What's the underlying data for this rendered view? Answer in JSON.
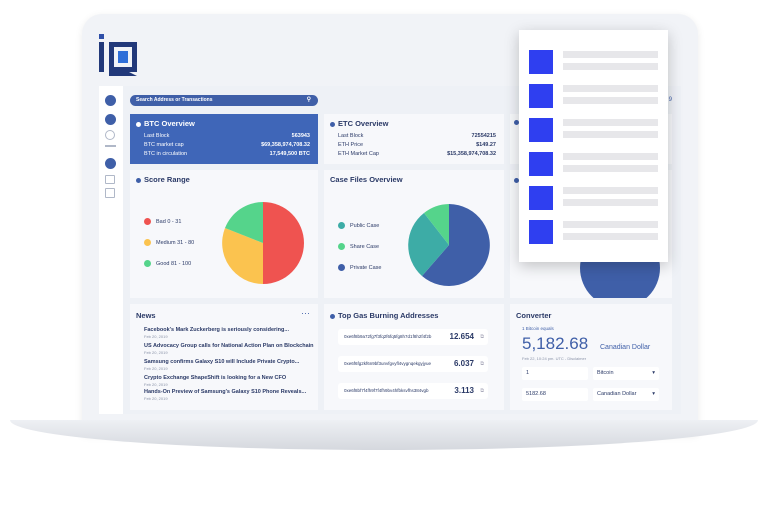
{
  "search": {
    "placeholder": "Search Address or Transactions",
    "icon": "search-icon"
  },
  "btc": {
    "title": "BTC Overview",
    "rows": [
      {
        "label": "Last Block",
        "value": "563943"
      },
      {
        "label": "BTC market cap",
        "value": "$69,358,974,708.32"
      },
      {
        "label": "BTC in circulation",
        "value": "17,549,500 BTC"
      }
    ]
  },
  "etc": {
    "title": "ETC Overview",
    "rows": [
      {
        "label": "Last Block",
        "value": "72554215"
      },
      {
        "label": "ETH Price",
        "value": "$149.27"
      },
      {
        "label": "ETH Market Cap",
        "value": "$15,358,974,708.32"
      }
    ]
  },
  "partial_value": "9",
  "score": {
    "title": "Score Range",
    "legend": [
      "Bad 0 - 31",
      "Medium 31 - 80",
      "Good 81 - 100"
    ],
    "colors": [
      "#ef5350",
      "#fbc34f",
      "#55d48b"
    ]
  },
  "casefiles": {
    "title": "Case Files Overview",
    "legend": [
      "Public Case",
      "Share Case",
      "Private Case"
    ],
    "colors": [
      "#3daca6",
      "#55d48b",
      "#3f5fa8"
    ]
  },
  "news": {
    "title": "News",
    "items": [
      {
        "title": "Facebook's Mark Zuckerberg is seriously considering...",
        "date": "Feb 20, 2019"
      },
      {
        "title": "US Advocacy Group calls for National Action Plan on Blockchain",
        "date": "Feb 20, 2019"
      },
      {
        "title": "Samsung confirms Galaxy S10 will Include Private Crypto...",
        "date": "Feb 20, 2019"
      },
      {
        "title": "Crypto Exchange ShapeShift is looking for a New CFO",
        "date": "Feb 20, 2019"
      },
      {
        "title": "Hands-On Preview of Samsung's Galaxy S10 Phone Reveals...",
        "date": "Feb 20, 2019"
      }
    ]
  },
  "gas": {
    "title": "Top Gas Burning Addresses",
    "rows": [
      {
        "address": "0xe6f8b9a72fg7f3fq2f6fq5fg8h7d1f8h2f4f2b",
        "value": "12.654"
      },
      {
        "address": "0xe6f6fg2kf6n9bf3unvfgvyfl4vygnqekgyjyue",
        "value": "6.037"
      },
      {
        "address": "0xe6f8bf7f4fh9f7f4fh9bv4hfbksvfhs384vgb",
        "value": "3.113"
      }
    ]
  },
  "converter": {
    "title": "Converter",
    "equals": "1 Bitcoin equals",
    "amount": "5,182.68",
    "currency": "Canadian Dollar",
    "timestamp": "Feb 22, 10:24 pm. UTC - Disclaimer",
    "input1": "1",
    "select1": "Bitcoin",
    "input2": "5182.68",
    "select2": "Canadian Dollar"
  }
}
